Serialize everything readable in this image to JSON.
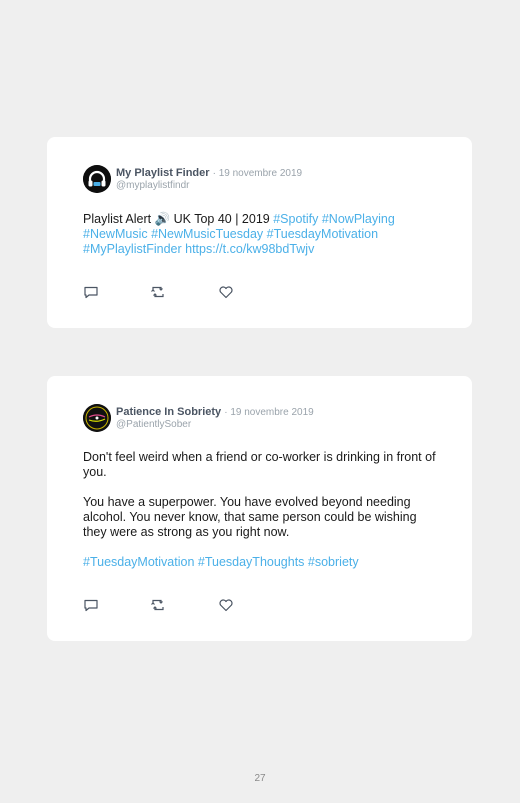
{
  "tweets": [
    {
      "author": "My Playlist Finder",
      "date": "· 19 novembre 2019",
      "handle": "@myplaylistfindr",
      "text_plain": "Playlist Alert 🔊 UK Top 40 | 2019 ",
      "tags_line1": "#Spotify #NowPlaying",
      "line2": "#NewMusic #NewMusicTuesday #TuesdayMotivation",
      "line3": "#MyPlaylistFinder https://t.co/kw98bdTwjv"
    },
    {
      "author": "Patience In Sobriety",
      "date": "· 19 novembre 2019",
      "handle": "@PatientlySober",
      "para1": "Don't feel weird when a friend or co-worker is drinking in front of you.",
      "para2": "You have a superpower. You have evolved beyond needing alcohol. You never know, that same person could be wishing they were as strong as you right now.",
      "para3": "#TuesdayMotivation #TuesdayThoughts #sobriety",
      "avatar_text": "PATIENCE IN SOBRIETY"
    }
  ],
  "icons": [
    "reply-icon",
    "retweet-icon",
    "like-icon"
  ],
  "colors": {
    "hashtag": "#4bb0e8",
    "name": "#4b5563",
    "meta": "#9aa3ab",
    "background": "#efefef"
  },
  "page_number": "27"
}
